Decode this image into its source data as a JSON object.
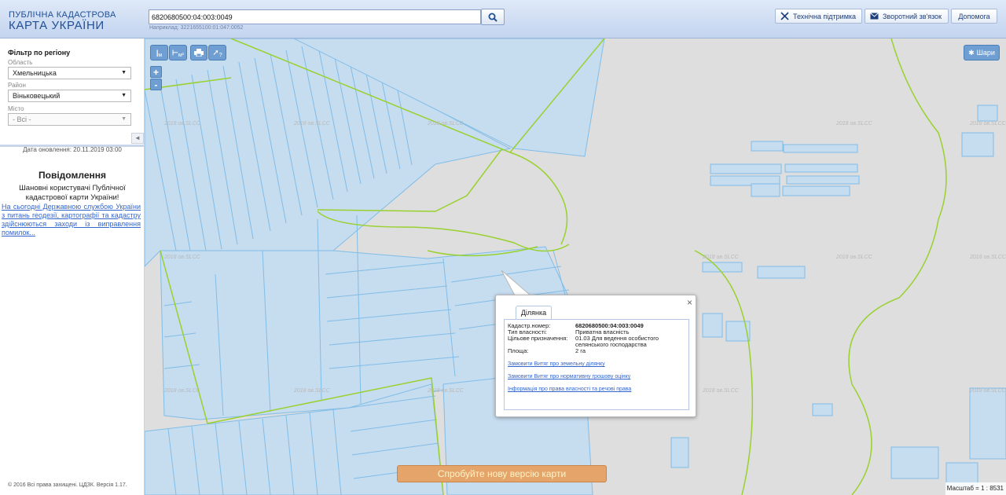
{
  "header": {
    "logo_line1": "ПУБЛІЧНА КАДАСТРОВА",
    "logo_line2": "КАРТА УКРАЇНИ",
    "search_value": "6820680500:04:003:0049",
    "search_hint": "Наприклад: 3221655100:01:047:0052",
    "support_label": "Технічна підтримка",
    "feedback_label": "Зворотний зв'язок",
    "help_label": "Допомога"
  },
  "sidebar": {
    "filter_title": "Фільтр по регіону",
    "oblast_label": "Область",
    "oblast_value": "Хмельницька",
    "raion_label": "Район",
    "raion_value": "Віньковецький",
    "city_label": "Місто",
    "city_value": "- Всі -",
    "update_date": "Дата оновлення: 20.11.2019 03:00",
    "notice_title": "Повідомлення",
    "notice_text": "Шановні користувачі Публічної кадастрової карти України!",
    "notice_link": "На сьогодні Державною службою України з питань геодезії, картографії та кадастру здійснюються заходи із виправлення помилок...",
    "copyright": "© 2016 Всі права захищені. ЦДЗК. Версія 1.17."
  },
  "map": {
    "tool_labels": [
      "м",
      "м²",
      "",
      "?"
    ],
    "zoom_in": "+",
    "zoom_out": "-",
    "layers_label": "Шари",
    "watermark": "2018 ов.SLCC",
    "try_new_label": "Спробуйте нову версію карти",
    "scale_text": "Масштаб = 1 : 8531",
    "colors": {
      "parcel": "#c6dcef",
      "parcel_border": "#80bde8",
      "boundary": "#99d12e",
      "background": "#dedede"
    }
  },
  "popup": {
    "tab_label": "Ділянка",
    "close_symbol": "×",
    "fields": [
      {
        "label": "Кадастр.номер:",
        "value": "6820680500:04:003:0049"
      },
      {
        "label": "Тип власності:",
        "value": "Приватна власність"
      },
      {
        "label": "Цільове призначення:",
        "value": "01.03 Для ведення особистого селянського господарства"
      },
      {
        "label": "Площа:",
        "value": "2 га"
      }
    ],
    "links": [
      "Замовити Витяг про земельну ділянку",
      "Замовити Витяг про нормативну грошову оцінку",
      "Інформація про права власності та речові права"
    ]
  }
}
